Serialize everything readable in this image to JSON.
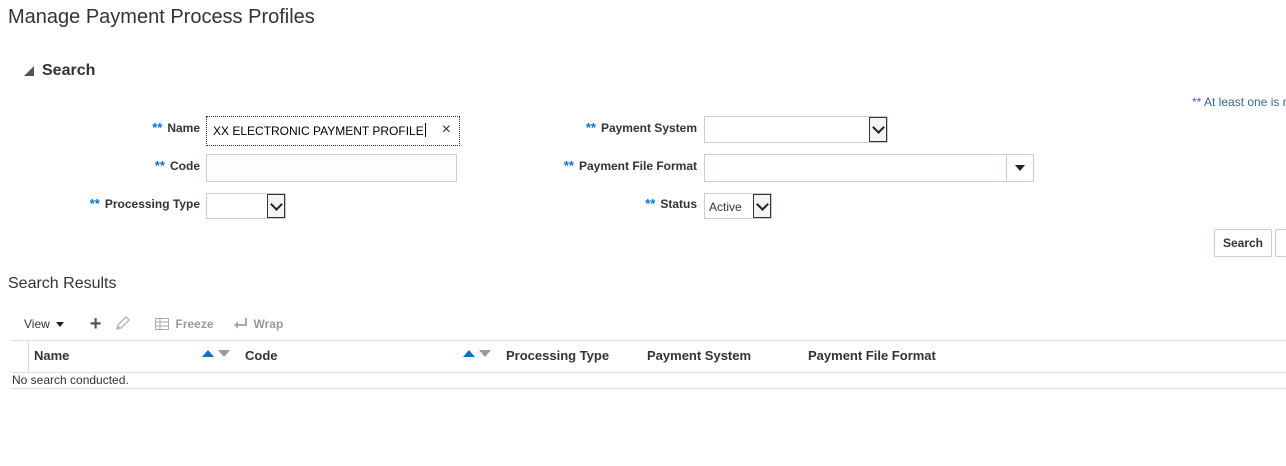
{
  "page": {
    "title": "Manage Payment Process Profiles"
  },
  "search": {
    "header": "Search",
    "required_hint": "** At least one is r",
    "required_marker": "**",
    "name": {
      "label": "Name",
      "value": "XX ELECTRONIC PAYMENT PROFILE",
      "clear_icon": "×"
    },
    "code": {
      "label": "Code",
      "value": ""
    },
    "processing_type": {
      "label": "Processing Type",
      "value": ""
    },
    "payment_system": {
      "label": "Payment System",
      "value": ""
    },
    "payment_file_format": {
      "label": "Payment File Format",
      "value": ""
    },
    "status": {
      "label": "Status",
      "value": "Active"
    },
    "search_button": "Search"
  },
  "results": {
    "title": "Search Results",
    "toolbar": {
      "view_label": "View",
      "freeze_label": "Freeze",
      "wrap_label": "Wrap"
    },
    "columns": [
      "Name",
      "Code",
      "Processing Type",
      "Payment System",
      "Payment File Format"
    ],
    "empty_message": "No search conducted."
  }
}
